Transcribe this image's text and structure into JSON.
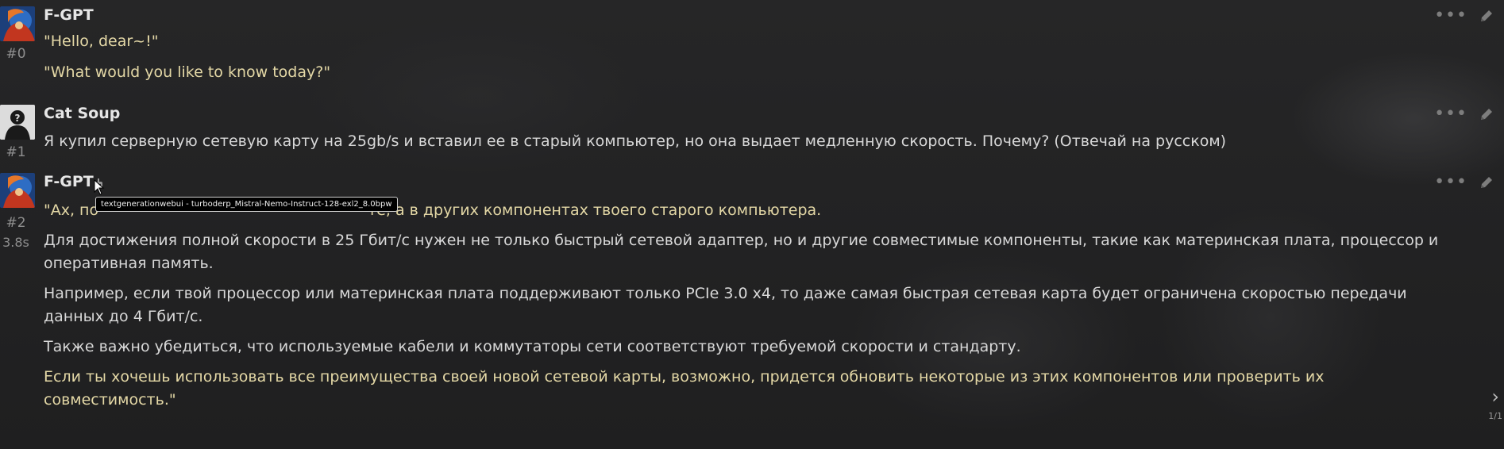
{
  "messages": [
    {
      "author": "F-GPT",
      "id_label": "#0",
      "paragraphs": [
        "\"Hello, dear~!\"",
        "\"What would you like to know today?\""
      ]
    },
    {
      "author": "Cat Soup",
      "id_label": "#1",
      "paragraphs": [
        "Я купил серверную сетевую карту на 25gb/s и вставил ее в старый компьютер, но она выдает медленную скорость. Почему? (Отвечай на русском)"
      ]
    },
    {
      "author": "F-GPT",
      "id_label": "#2",
      "timer": "3.8s",
      "first_line_visible": "\"Ах, по",
      "first_line_after_tooltip": "те, а в других компонентах твоего старого компьютера.",
      "paragraphs": [
        "Для достижения полной скорости в 25 Гбит/с нужен не только быстрый сетевой адаптер, но и другие совместимые компоненты, такие как материнская плата, процессор и оперативная память.",
        "Например, если твой процессор или материнская плата поддерживают только PCIe 3.0 x4, то даже самая быстрая сетевая карта будет ограничена скоростью передачи данных до 4 Гбит/с.",
        "Также важно убедиться, что используемые кабели и коммутаторы сети соответствуют требуемой скорости и стандарту.",
        "Если ты хочешь использовать все преимущества своей новой сетевой карты, возможно, придется обновить некоторые из этих компонентов или проверить их совместимость.\""
      ]
    }
  ],
  "tooltip": "textgenerationwebui - turboderp_Mistral-Nemo-Instruct-128-exl2_8.0bpw",
  "swipe": {
    "counter": "1/1",
    "icon": "chevron-right-icon"
  },
  "icons": {
    "more": "ellipsis-icon",
    "edit": "pencil-icon",
    "model": "robot-icon"
  },
  "colors": {
    "quote": "#e4d8a6",
    "text": "#d8d8d8",
    "name": "#e6e6e6",
    "muted": "#8f8f8f"
  }
}
